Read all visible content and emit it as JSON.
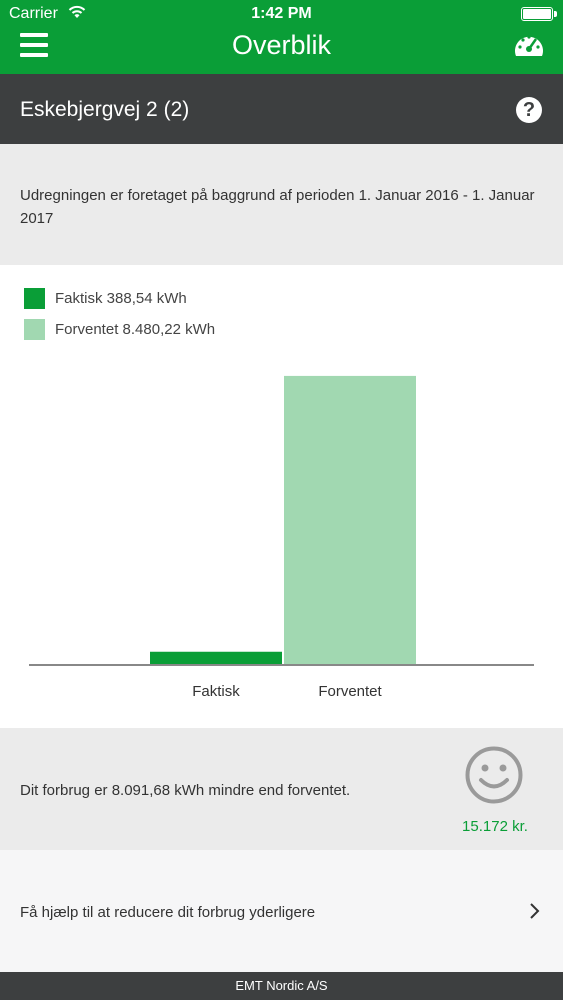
{
  "status_bar": {
    "carrier": "Carrier",
    "time": "1:42 PM"
  },
  "nav": {
    "title": "Overblik",
    "menu_icon": "menu-icon",
    "gauge_icon": "gauge-icon"
  },
  "address": {
    "name": "Eskebjergvej 2 (2)",
    "help_label": "?"
  },
  "period": {
    "text": "Udregningen er foretaget på baggrund af perioden 1. Januar 2016 - 1. Januar 2017"
  },
  "legend": [
    {
      "label": "Faktisk 388,54 kWh",
      "color": "#0a9e37"
    },
    {
      "label": "Forventet 8.480,22 kWh",
      "color": "#a1d8b1"
    }
  ],
  "chart_data": {
    "type": "bar",
    "categories": [
      "Faktisk",
      "Forventet"
    ],
    "values": [
      388.54,
      8480.22
    ],
    "colors": [
      "#0a9e37",
      "#a1d8b1"
    ],
    "ylim": [
      0,
      8800
    ],
    "grid": false,
    "legend": "top-left"
  },
  "summary": {
    "text": "Dit forbrug er 8.091,68 kWh mindre end forventet.",
    "savings": "15.172 kr.",
    "icon": "smiley-icon"
  },
  "help_row": {
    "text": "Få hjælp til at reducere dit forbrug yderligere",
    "icon": "chevron-right-icon"
  },
  "footer": {
    "text": "EMT Nordic A/S"
  },
  "colors": {
    "brand_green": "#0a9e37",
    "dark_bar": "#3d3f40",
    "light_green": "#a1d8b1"
  }
}
